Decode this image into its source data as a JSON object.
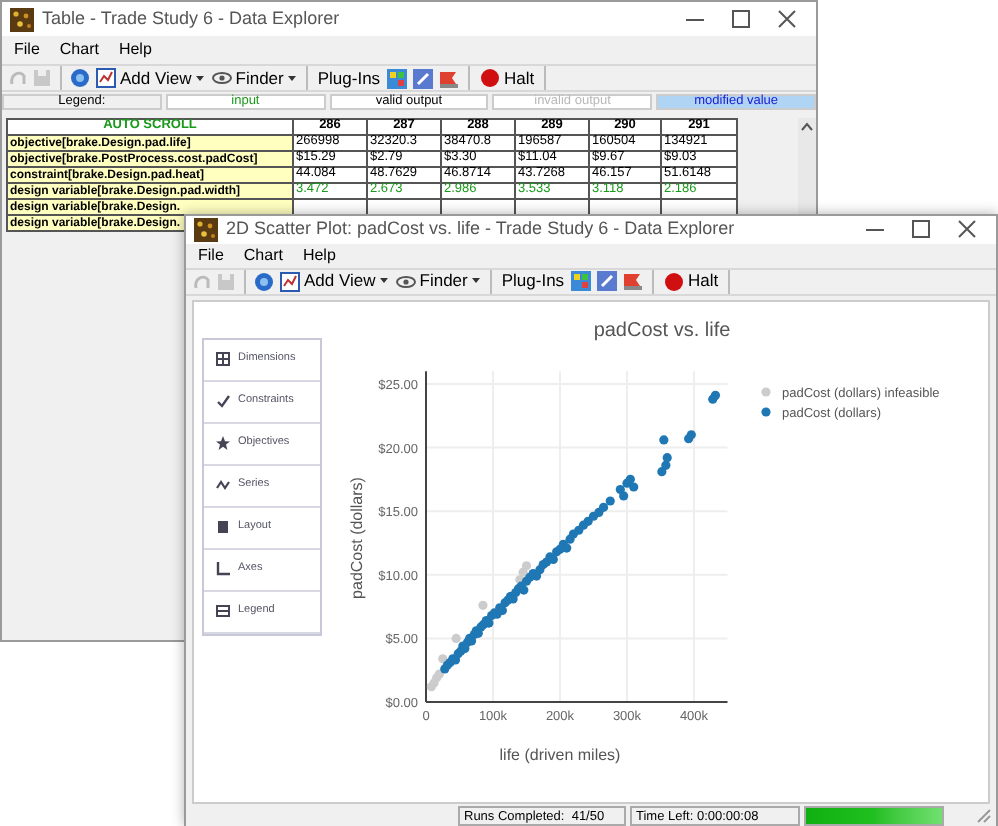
{
  "table_window": {
    "title": "Table - Trade Study 6 - Data Explorer",
    "menu": [
      "File",
      "Chart",
      "Help"
    ],
    "toolbar": [
      {
        "label": "Add View",
        "kind": "dropdown"
      },
      {
        "label": "Finder",
        "kind": "dropdown"
      },
      {
        "label": "Plug-Ins",
        "kind": "label"
      },
      {
        "label": "Halt",
        "kind": "button"
      }
    ],
    "legend": [
      {
        "label": "Legend:",
        "kind": "heading"
      },
      {
        "label": "input",
        "kind": "input"
      },
      {
        "label": "valid output",
        "kind": "valid"
      },
      {
        "label": "invalid output",
        "kind": "invalid"
      },
      {
        "label": "modified value",
        "kind": "modified"
      }
    ],
    "table": {
      "columns": [
        "AUTO SCROLL",
        "286",
        "287",
        "288",
        "289",
        "290",
        "291"
      ],
      "rows": [
        {
          "kind": "valid",
          "cells": [
            "objective[brake.Design.pad.life]",
            "266998",
            "32320.3",
            "38470.8",
            "196587",
            "160504",
            "134921"
          ]
        },
        {
          "kind": "valid",
          "cells": [
            "objective[brake.PostProcess.cost.padCost]",
            "$15.29",
            "$2.79",
            "$3.30",
            "$11.04",
            "$9.67",
            "$9.03"
          ]
        },
        {
          "kind": "valid",
          "cells": [
            "constraint[brake.Design.pad.heat]",
            "44.084",
            "48.7629",
            "46.8714",
            "43.7268",
            "46.157",
            "51.6148"
          ]
        },
        {
          "kind": "input",
          "cells": [
            "design variable[brake.Design.pad.width]",
            "3.472",
            "2.673",
            "2.986",
            "3.533",
            "3.118",
            "2.186"
          ]
        },
        {
          "cells": [
            "design variable[brake.Design."
          ]
        },
        {
          "cells": [
            "design variable[brake.Design."
          ]
        }
      ]
    }
  },
  "plot_window": {
    "title": "2D Scatter Plot: padCost vs. life - Trade Study 6 - Data Explorer",
    "menu": [
      "File",
      "Chart",
      "Help"
    ],
    "toolbar": [
      {
        "label": "Add View",
        "kind": "dropdown"
      },
      {
        "label": "Finder",
        "kind": "dropdown"
      },
      {
        "label": "Plug-Ins",
        "kind": "label"
      },
      {
        "label": "Halt",
        "kind": "button"
      }
    ],
    "sidebar": [
      "Dimensions",
      "Constraints",
      "Objectives",
      "Series",
      "Layout",
      "Axes",
      "Legend"
    ],
    "chart_data": {
      "type": "scatter",
      "title": "padCost vs. life",
      "xlabel": "life (driven miles)",
      "ylabel": "padCost (dollars)",
      "xlim": [
        0,
        450000
      ],
      "ylim": [
        0,
        26
      ],
      "grid": true,
      "legend": true,
      "xticks": [
        {
          "value": 0,
          "label": "0"
        },
        {
          "value": 100000,
          "label": "100k"
        },
        {
          "value": 200000,
          "label": "200k"
        },
        {
          "value": 300000,
          "label": "300k"
        },
        {
          "value": 400000,
          "label": "400k"
        }
      ],
      "yticks": [
        {
          "value": 0,
          "label": "$0.00"
        },
        {
          "value": 5,
          "label": "$5.00"
        },
        {
          "value": 10,
          "label": "$10.00"
        },
        {
          "value": 15,
          "label": "$15.00"
        },
        {
          "value": 20,
          "label": "$20.00"
        },
        {
          "value": 25,
          "label": "$25.00"
        }
      ],
      "series": [
        {
          "name": "padCost (dollars) infeasible",
          "color": "#cccccc",
          "x": [
            8000,
            12000,
            16000,
            20000,
            25000,
            45000,
            85000,
            140000,
            145000,
            150000
          ],
          "values": [
            1.2,
            1.5,
            1.9,
            2.2,
            3.4,
            5.0,
            7.6,
            9.6,
            10.2,
            10.7
          ]
        },
        {
          "name": "padCost (dollars)",
          "color": "#1f77b4",
          "x": [
            28000,
            32000,
            36000,
            40000,
            44000,
            48000,
            52000,
            55000,
            58000,
            62000,
            65000,
            68000,
            72000,
            75000,
            78000,
            82000,
            86000,
            90000,
            94000,
            98000,
            102000,
            106000,
            110000,
            114000,
            118000,
            122000,
            126000,
            130000,
            134000,
            138000,
            142000,
            146000,
            150000,
            155000,
            160000,
            165000,
            170000,
            175000,
            180000,
            185000,
            190000,
            195000,
            200000,
            205000,
            210000,
            215000,
            220000,
            228000,
            235000,
            242000,
            250000,
            258000,
            265000,
            275000,
            290000,
            295000,
            300000,
            305000,
            310000,
            352000,
            355000,
            358000,
            360000,
            392000,
            396000,
            428000,
            432000
          ],
          "values": [
            2.6,
            2.9,
            3.1,
            3.4,
            3.3,
            3.8,
            4.0,
            4.4,
            4.2,
            4.7,
            5.0,
            4.8,
            5.3,
            5.6,
            5.4,
            5.9,
            6.1,
            6.4,
            6.2,
            6.8,
            7.0,
            6.9,
            7.4,
            7.2,
            7.8,
            8.0,
            8.3,
            8.1,
            8.6,
            8.9,
            9.1,
            8.8,
            9.5,
            9.8,
            10.1,
            9.9,
            10.4,
            10.8,
            11.0,
            11.4,
            11.2,
            11.8,
            12.0,
            12.4,
            12.1,
            12.8,
            13.2,
            13.5,
            13.9,
            14.2,
            14.6,
            14.9,
            15.3,
            15.8,
            16.7,
            16.2,
            17.2,
            17.5,
            16.9,
            18.1,
            20.6,
            18.6,
            19.2,
            20.7,
            21.0,
            23.8,
            24.1
          ]
        }
      ]
    },
    "status_bar": {
      "runs": "Runs Completed:  41/50",
      "time_left": "Time Left: 0:00:00:08",
      "progress": {
        "level": 1
      }
    }
  }
}
